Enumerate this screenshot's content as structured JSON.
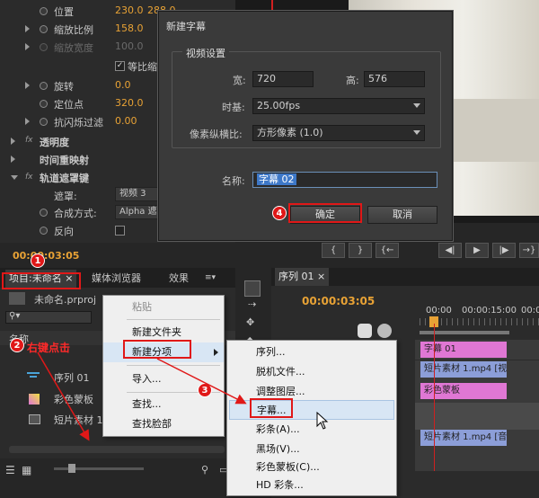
{
  "effect_controls": {
    "position": {
      "label": "位置",
      "x": "230.0",
      "y": "288.0"
    },
    "scale": {
      "label": "缩放比例",
      "value": "158.0"
    },
    "scale_width": {
      "label": "缩放宽度",
      "value": "100.0"
    },
    "uniform_scale": "等比缩",
    "rotation": {
      "label": "旋转",
      "value": "0.0"
    },
    "anchor": {
      "label": "定位点",
      "value": "320.0"
    },
    "antiflicker": {
      "label": "抗闪烁过滤",
      "value": "0.00"
    },
    "opacity": "透明度",
    "time_remap": "时间重映射",
    "track_matte": "轨道遮罩键",
    "matte": {
      "label": "遮罩:",
      "value": "视频 3"
    },
    "composite": {
      "label": "合成方式:",
      "value": "Alpha 遮"
    },
    "reverse": "反向",
    "timecode": "00:00:03:05",
    "fx": "fx"
  },
  "dialog": {
    "title": "新建字幕",
    "group": "视频设置",
    "width_label": "宽:",
    "width": "720",
    "height_label": "高:",
    "height": "576",
    "timebase_label": "时基:",
    "timebase": "25.00fps",
    "par_label": "像素纵横比:",
    "par": "方形像素 (1.0)",
    "name_label": "名称:",
    "name": "字幕 02",
    "ok": "确定",
    "cancel": "取消"
  },
  "playback": [
    "{",
    "}",
    "{←",
    "◀|",
    "▶",
    "|▶",
    "→}"
  ],
  "project": {
    "tab_project": "项目:未命名",
    "tab_media": "媒体浏览器",
    "tab_effects": "效果",
    "file": "未命名.prproj",
    "col_name": "名称",
    "items": [
      "序列 01",
      "彩色蒙板",
      "短片素材 1"
    ]
  },
  "context_menu": {
    "items": [
      "粘贴",
      "新建文件夹",
      "新建分项",
      "导入...",
      "查找...",
      "查找脸部"
    ]
  },
  "submenu": {
    "items": [
      "序列...",
      "脱机文件...",
      "调整图层...",
      "字幕...",
      "彩条(A)...",
      "黑场(V)...",
      "彩色蒙板(C)...",
      "HD 彩条..."
    ]
  },
  "timeline": {
    "tab": "序列 01",
    "timecode": "00:00:03:05",
    "ruler": [
      "00:00",
      "00:00:15:00",
      "00:0"
    ],
    "clips": [
      {
        "label": "字幕 01",
        "color": "#e077d4"
      },
      {
        "label": "短片素材 1.mp4 [视]",
        "color": "#8c9ed8"
      },
      {
        "label": "彩色蒙板",
        "color": "#e077d4"
      },
      {
        "label": "短片素材 1.mp4 [音]",
        "color": "#8c9ed8"
      }
    ]
  },
  "annotations": {
    "b1": "1",
    "b2": "2",
    "b2_text": "右键点击",
    "b3": "3",
    "b4": "4"
  },
  "colors": {
    "accent": "#e8a235",
    "highlight": "#e01818",
    "clip_pink": "#e077d4",
    "clip_blue": "#8c9ed8"
  }
}
